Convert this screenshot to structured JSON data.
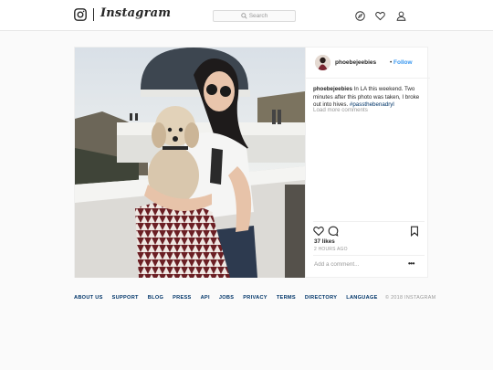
{
  "header": {
    "wordmark": "Instagram",
    "search_placeholder": "Search",
    "icons": [
      "instagram-logo-icon",
      "search-icon",
      "compass-icon",
      "heart-icon",
      "profile-icon"
    ]
  },
  "post": {
    "username": "phoebejeebies",
    "separator": "•",
    "follow_label": "Follow",
    "caption_user": "phoebejeebies",
    "caption_text": " In LA this weekend. Two minutes after this photo was taken, I broke out into hives. ",
    "caption_hashtag": "#passthebenadryl",
    "load_more": "Load more comments",
    "likes": "37 likes",
    "time": "2 HOURS AGO",
    "add_comment_placeholder": "Add a comment...",
    "more_options": "•••",
    "action_icons": [
      "heart-icon",
      "comment-icon",
      "bookmark-icon"
    ]
  },
  "footer": {
    "links": [
      "ABOUT US",
      "SUPPORT",
      "BLOG",
      "PRESS",
      "API",
      "JOBS",
      "PRIVACY",
      "TERMS",
      "DIRECTORY",
      "LANGUAGE"
    ],
    "copyright": "© 2018 INSTAGRAM"
  },
  "colors": {
    "link_blue": "#3897f0",
    "hashtag_blue": "#003569",
    "text": "#262626",
    "muted": "#999999",
    "border": "#efefef",
    "page_bg": "#fafafa"
  }
}
